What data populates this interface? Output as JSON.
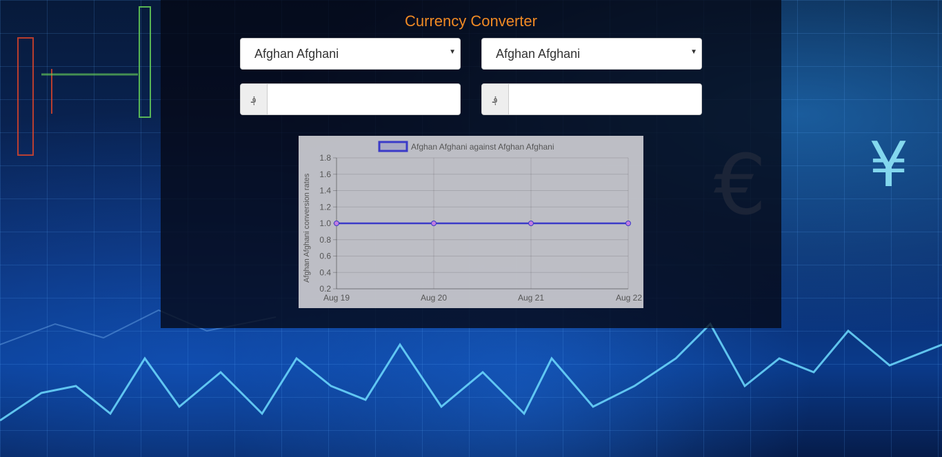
{
  "title": "Currency Converter",
  "from": {
    "selected": "Afghan Afghani",
    "symbol": "؋",
    "amount": ""
  },
  "to": {
    "selected": "Afghan Afghani",
    "symbol": "؋",
    "amount": ""
  },
  "colors": {
    "title": "#f08a24",
    "line": "#3a3ac8",
    "point": "#c27ce0"
  },
  "chart_data": {
    "type": "line",
    "legend": "Afghan Afghani against Afghan Afghani",
    "ylabel": "Afghan Afghani conversion rates",
    "xlabel": "",
    "categories": [
      "Aug 19",
      "Aug 20",
      "Aug 21",
      "Aug 22"
    ],
    "series": [
      {
        "name": "Afghan Afghani against Afghan Afghani",
        "values": [
          1.0,
          1.0,
          1.0,
          1.0
        ]
      }
    ],
    "ylim": [
      0.2,
      1.8
    ],
    "yticks": [
      1.8,
      1.6,
      1.4,
      1.2,
      1.0,
      0.8,
      0.6,
      0.4,
      0.2
    ],
    "grid": true,
    "legend_position": "top"
  }
}
